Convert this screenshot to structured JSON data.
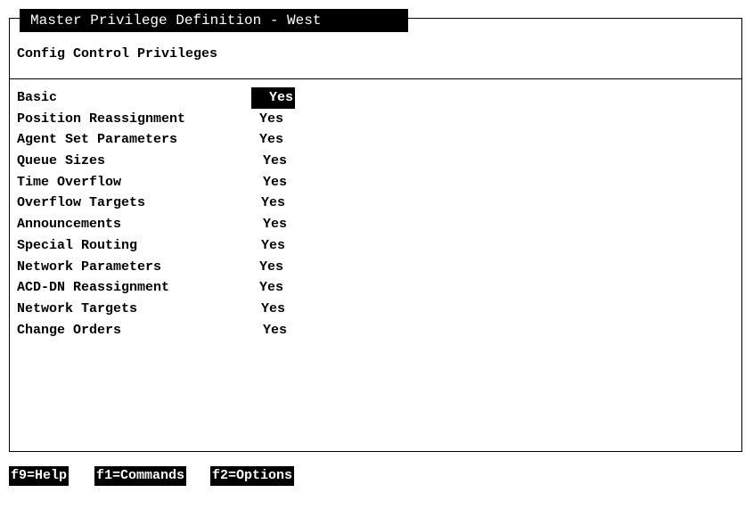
{
  "window": {
    "title": "Master Privilege Definition - West"
  },
  "section": {
    "title": "Config Control Privileges"
  },
  "privileges": [
    {
      "label": "Basic",
      "value": "Yes"
    },
    {
      "label": "Position Reassignment",
      "value": "Yes"
    },
    {
      "label": "Agent Set Parameters",
      "value": "Yes"
    },
    {
      "label": "Queue Sizes",
      "value": "Yes"
    },
    {
      "label": "Time Overflow",
      "value": "Yes"
    },
    {
      "label": "Overflow Targets",
      "value": "Yes"
    },
    {
      "label": "Announcements",
      "value": "Yes"
    },
    {
      "label": "Special Routing",
      "value": "Yes"
    },
    {
      "label": "Network Parameters",
      "value": "Yes"
    },
    {
      "label": "ACD-DN Reassignment",
      "value": "Yes"
    },
    {
      "label": "Network Targets",
      "value": "Yes"
    },
    {
      "label": "Change Orders",
      "value": "Yes"
    }
  ],
  "function_keys": [
    {
      "key": "f9",
      "label": "Help"
    },
    {
      "key": "f1",
      "label": "Commands"
    },
    {
      "key": "f2",
      "label": "Options"
    }
  ]
}
